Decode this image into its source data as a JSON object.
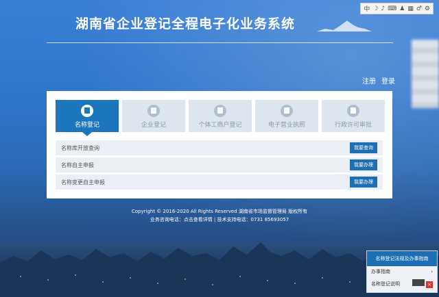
{
  "header": {
    "title": "湖南省企业登记全程电子化业务系统"
  },
  "browser_extension": {
    "icons": [
      "中",
      "☽",
      "♪",
      "⌨",
      "♟",
      "▦",
      "♂",
      "⚙"
    ]
  },
  "auth": {
    "register": "注册",
    "login": "登录"
  },
  "tabs": [
    {
      "label": "名称登记",
      "icon": "document-icon",
      "active": true
    },
    {
      "label": "企业登记",
      "icon": "building-icon",
      "active": false
    },
    {
      "label": "个体工商户登记",
      "icon": "shop-icon",
      "active": false
    },
    {
      "label": "电子营业执照",
      "icon": "license-icon",
      "active": false
    },
    {
      "label": "行政许可审批",
      "icon": "user-icon",
      "active": false
    }
  ],
  "rows": [
    {
      "text": "名称库开放查询",
      "button": "我要查询"
    },
    {
      "text": "名称自主申报",
      "button": "我要办理"
    },
    {
      "text": "名称变更自主申报",
      "button": "我要办理"
    }
  ],
  "footer": {
    "line1": "Copyright © 2016-2020 All Rights Reserved 湖南省市场监督管理局 版权所有",
    "line2": "业务咨询电话：点击查看详情   |   技术支持电话：0731 85693057"
  },
  "dock": {
    "header": "名称登记法规及办事指南",
    "item1": "办事指南",
    "item2": "名称登记说明"
  },
  "colors": {
    "accent": "#1c76bc",
    "tab_inactive": "#dde6ee"
  }
}
